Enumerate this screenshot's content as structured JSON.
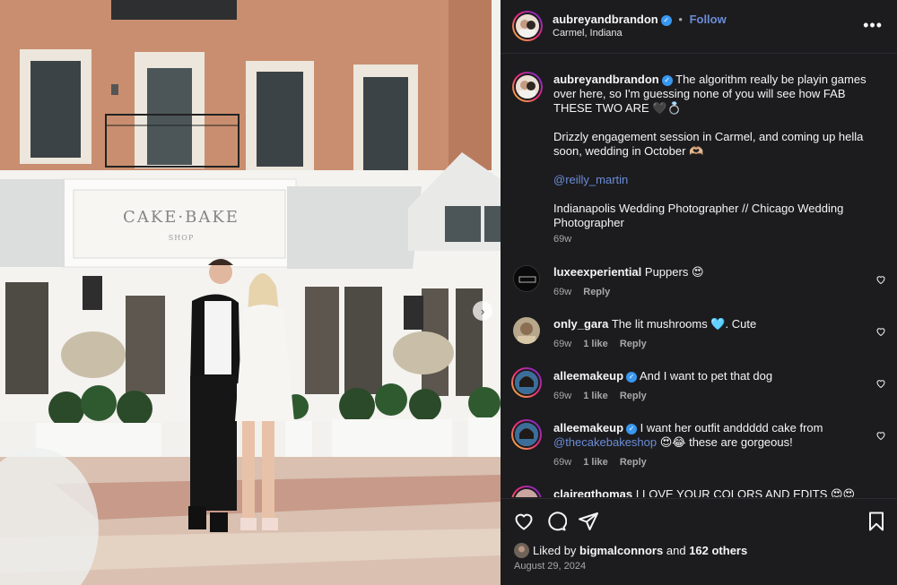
{
  "photo": {
    "sign_main": "CAKE·BAKE",
    "sign_sub": "SHOP"
  },
  "header": {
    "username": "aubreyandbrandon",
    "separator": "•",
    "follow": "Follow",
    "location": "Carmel, Indiana",
    "more": "•••"
  },
  "caption": {
    "username": "aubreyandbrandon",
    "line1": "The algorithm really be playin games over here, so I'm guessing none of you will see how FAB THESE TWO ARE 🖤💍",
    "line2": "Drizzly engagement session in Carmel, and coming up hella soon, wedding in October 🫶🏼",
    "mention": "@reilly_martin",
    "line3": "Indianapolis Wedding Photographer // Chicago Wedding Photographer",
    "time": "69w"
  },
  "comments": [
    {
      "username": "luxeexperiential",
      "text": "Puppers 😍",
      "time": "69w",
      "likes": "",
      "reply": "Reply",
      "verified": false
    },
    {
      "username": "only_gara",
      "text": "The lit mushrooms 🩵. Cute",
      "time": "69w",
      "likes": "1 like",
      "reply": "Reply",
      "verified": false
    },
    {
      "username": "alleemakeup",
      "text": "And I want to pet that dog",
      "time": "69w",
      "likes": "1 like",
      "reply": "Reply",
      "verified": true
    },
    {
      "username": "alleemakeup",
      "text": "I want her outfit anddddd cake from",
      "mention": "@thecakebakeshop",
      "text2": "😍😂 these are gorgeous!",
      "time": "69w",
      "likes": "1 like",
      "reply": "Reply",
      "verified": true
    },
    {
      "username": "clairegthomas",
      "text": "I LOVE YOUR COLORS AND EDITS 😍😍😍",
      "verified": false
    }
  ],
  "footer": {
    "liked_prefix": "Liked by",
    "liked_user": "bigmalconnors",
    "liked_and": "and",
    "liked_others": "162 others",
    "date": "August 29, 2024"
  },
  "icons": {
    "heart": "heart-icon",
    "comment": "comment-icon",
    "share": "share-icon",
    "save": "bookmark-icon",
    "more": "more-icon",
    "verified": "verified-badge-icon",
    "next": "chevron-right-icon"
  },
  "colors": {
    "panel_bg": "#1c1c1f",
    "link": "#6b8dd6",
    "verified": "#3897f0",
    "muted": "#a8a8a8"
  }
}
